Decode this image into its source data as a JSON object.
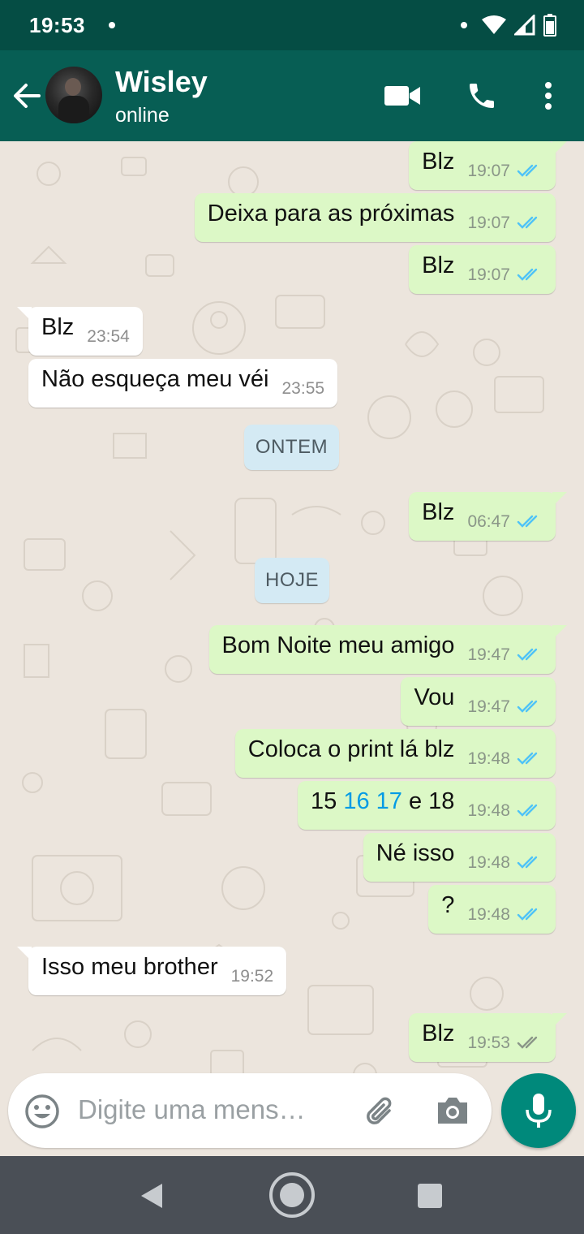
{
  "status_bar": {
    "time": "19:53"
  },
  "header": {
    "contact_name": "Wisley",
    "contact_status": "online",
    "icons": [
      "arrow-back-icon",
      "videocam-icon",
      "phone-icon",
      "more-vert-icon"
    ]
  },
  "messages": [
    {
      "text": "Blz",
      "time": "19:07",
      "direction": "out",
      "ticks": "read"
    },
    {
      "text": "Deixa para as próximas",
      "time": "19:07",
      "direction": "out",
      "ticks": "read"
    },
    {
      "text": "Blz",
      "time": "19:07",
      "direction": "out",
      "ticks": "read"
    },
    {
      "text": "Blz",
      "time": "23:54",
      "direction": "in"
    },
    {
      "text": "Não esqueça meu véi",
      "time": "23:55",
      "direction": "in"
    },
    {
      "date_chip": "ONTEM"
    },
    {
      "text": "Blz",
      "time": "06:47",
      "direction": "out",
      "ticks": "read"
    },
    {
      "date_chip": "HOJE"
    },
    {
      "text": "Bom Noite meu amigo",
      "time": "19:47",
      "direction": "out",
      "ticks": "read"
    },
    {
      "text": "Vou",
      "time": "19:47",
      "direction": "out",
      "ticks": "read"
    },
    {
      "text": "Coloca o print lá blz",
      "time": "19:48",
      "direction": "out",
      "ticks": "read"
    },
    {
      "text_parts": [
        "15 ",
        "16",
        " ",
        "17",
        " e 18"
      ],
      "time": "19:48",
      "direction": "out",
      "ticks": "read"
    },
    {
      "text": "Né isso",
      "time": "19:48",
      "direction": "out",
      "ticks": "read"
    },
    {
      "text": "?",
      "time": "19:48",
      "direction": "out",
      "ticks": "read"
    },
    {
      "text": "Isso meu brother",
      "time": "19:52",
      "direction": "in"
    },
    {
      "text": "Blz",
      "time": "19:53",
      "direction": "out",
      "ticks": "delivered"
    }
  ],
  "composer": {
    "placeholder": "Digite uma mens…",
    "icons": [
      "emoji-icon",
      "attach-icon",
      "camera-icon",
      "mic-icon"
    ]
  },
  "colors": {
    "header": "#075e54",
    "status_bar": "#054d44",
    "outgoing_bubble": "#dcf8c6",
    "incoming_bubble": "#ffffff",
    "date_chip": "#d4eaf4",
    "read_ticks": "#4fc3f7",
    "link": "#039be5",
    "mic_button": "#00897b"
  }
}
